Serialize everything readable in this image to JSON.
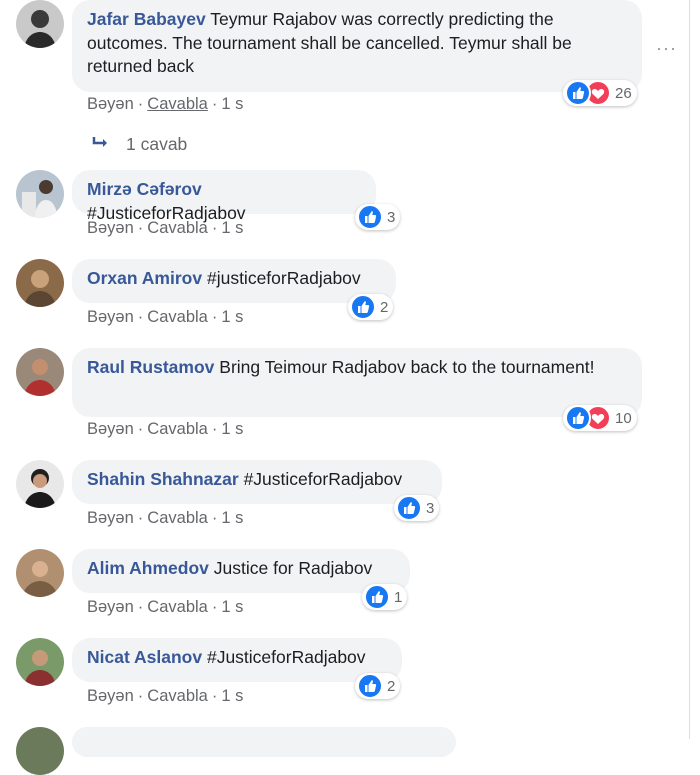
{
  "labels": {
    "like": "Bəyən",
    "reply": "Cavabla",
    "separator": "·",
    "more": "···"
  },
  "replies": {
    "label": "1 cavab"
  },
  "comments": [
    {
      "author": "Jafar Babayev",
      "text": "Teymur Rajabov was correctly predicting the outcomes. The tournament shall be cancelled. Teymur shall be returned back",
      "time": "1 s",
      "reactions": [
        "like",
        "love"
      ],
      "count": "26"
    },
    {
      "author": "Mirzə Cəfərov",
      "text": "#JusticeforRadjabov",
      "time": "1 s",
      "reactions": [
        "like"
      ],
      "count": "3"
    },
    {
      "author": "Orxan Amirov",
      "text": "#justiceforRadjabov",
      "time": "1 s",
      "reactions": [
        "like"
      ],
      "count": "2"
    },
    {
      "author": "Raul Rustamov",
      "text": "Bring Teimour Radjabov back to the tournament!",
      "time": "1 s",
      "reactions": [
        "like",
        "love"
      ],
      "count": "10"
    },
    {
      "author": "Shahin Shahnazar",
      "text": "#JusticeforRadjabov",
      "time": "1 s",
      "reactions": [
        "like"
      ],
      "count": "3"
    },
    {
      "author": "Alim Ahmedov",
      "text": "Justice for Radjabov",
      "time": "1 s",
      "reactions": [
        "like"
      ],
      "count": "1"
    },
    {
      "author": "Nicat Aslanov",
      "text": "#JusticeforRadjabov",
      "time": "1 s",
      "reactions": [
        "like"
      ],
      "count": "2"
    }
  ],
  "colors": {
    "author": "#385898",
    "bubble": "#f2f3f5",
    "meta": "#65676b",
    "like": "#1877f2",
    "love": "#f33e58"
  }
}
